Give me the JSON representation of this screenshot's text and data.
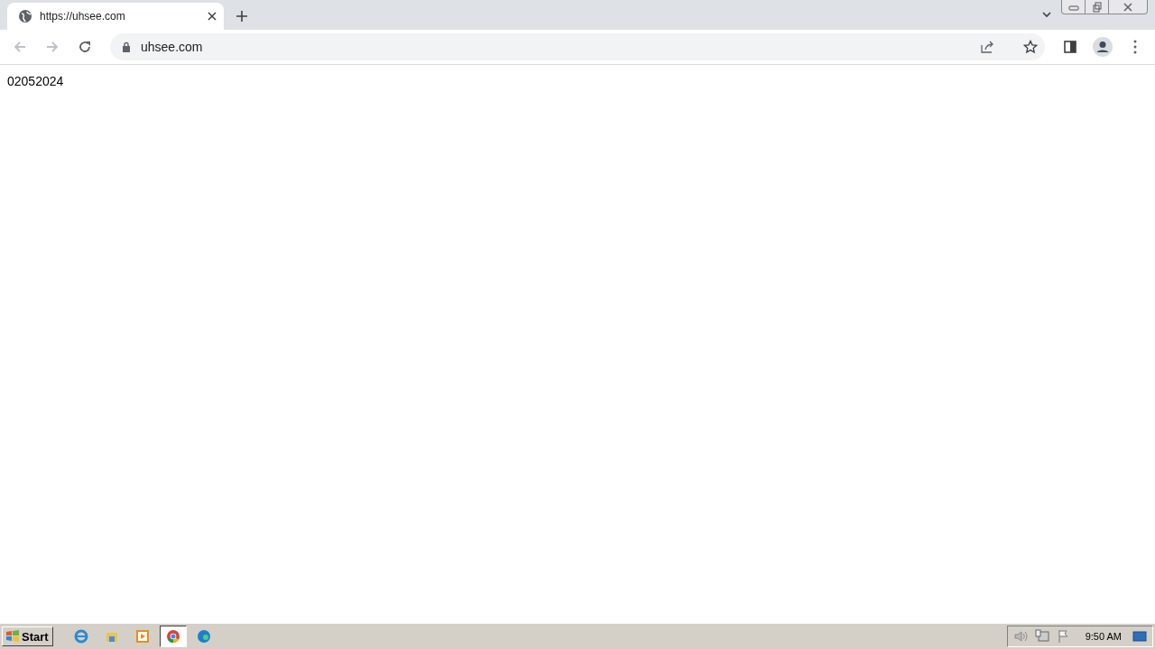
{
  "browser": {
    "tab": {
      "title": "https://uhsee.com"
    },
    "address": {
      "value": "uhsee.com"
    }
  },
  "page": {
    "text": "02052024"
  },
  "taskbar": {
    "start": "Start",
    "apps": [
      {
        "kind": "ie",
        "selected": false
      },
      {
        "kind": "folder",
        "selected": false
      },
      {
        "kind": "media",
        "selected": false
      },
      {
        "kind": "chrome",
        "selected": true
      },
      {
        "kind": "edge",
        "selected": false
      }
    ],
    "clock": "9:50 AM"
  }
}
